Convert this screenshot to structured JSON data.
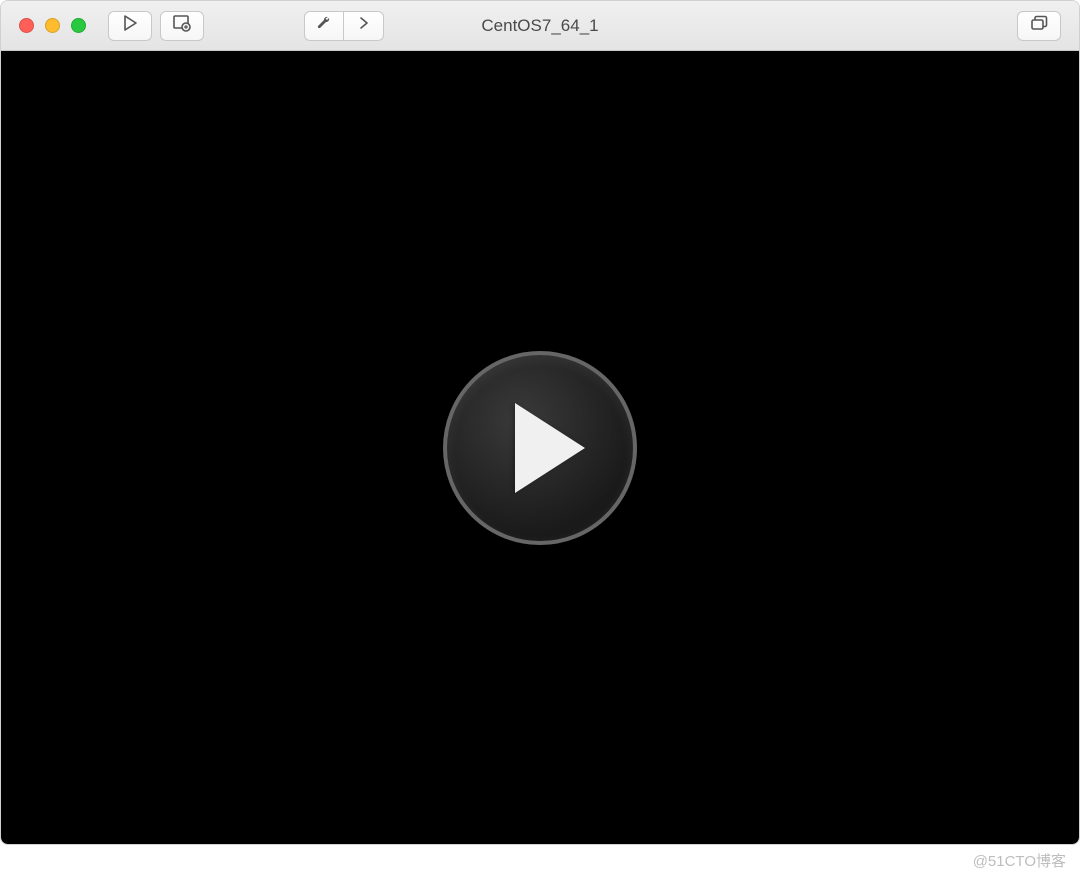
{
  "window": {
    "title": "CentOS7_64_1"
  },
  "toolbar": {
    "play_icon": "play-icon",
    "snapshot_icon": "snapshot-icon",
    "settings_icon": "wrench-icon",
    "next_icon": "chevron-right-icon",
    "fullscreen_icon": "stack-icon"
  },
  "vm": {
    "state_icon": "play-overlay-icon"
  },
  "watermark": "@51CTO博客"
}
